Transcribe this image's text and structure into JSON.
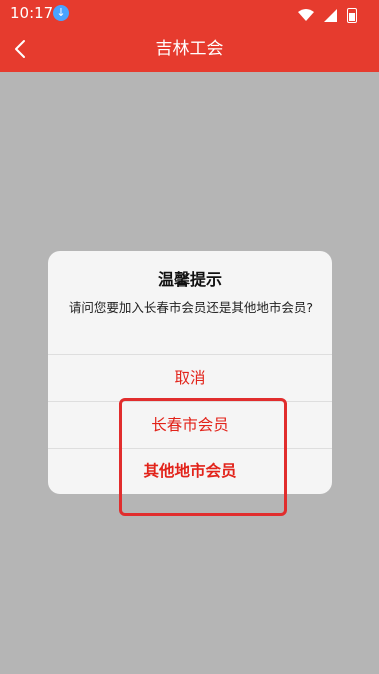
{
  "status_bar": {
    "time": "10:17"
  },
  "app_bar": {
    "title": "吉林工会"
  },
  "dialog": {
    "title": "温馨提示",
    "message": "请问您要加入长春市会员还是其他地市会员?",
    "buttons": {
      "cancel": "取消",
      "changchun_member": "长春市会员",
      "other_city_member": "其他地市会员"
    }
  },
  "colors": {
    "brand_red": "#e63b2e",
    "overlay_gray": "#b5b5b5",
    "dialog_bg": "#f5f5f5",
    "button_text_red": "#e2231a",
    "highlight_outline": "#e12d2d"
  },
  "icons": {
    "download_indicator": "download-icon",
    "wifi": "wifi-icon",
    "signal": "signal-icon",
    "battery": "battery-icon",
    "back": "back-arrow-icon"
  }
}
